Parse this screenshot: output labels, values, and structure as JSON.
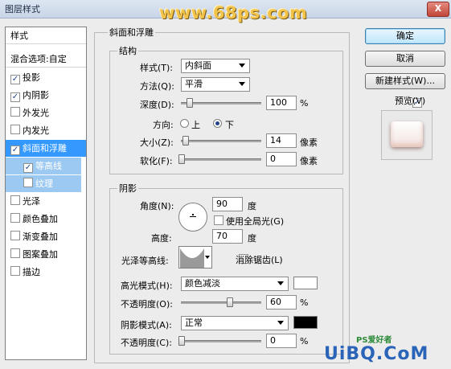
{
  "window": {
    "title": "图层样式",
    "close_glyph": "X",
    "watermark": "www.68ps.com"
  },
  "left_panel": {
    "header": "样式",
    "blend_options": "混合选项:自定",
    "items": [
      {
        "label": "投影",
        "checked": true
      },
      {
        "label": "内阴影",
        "checked": true
      },
      {
        "label": "外发光",
        "checked": false
      },
      {
        "label": "内发光",
        "checked": false
      },
      {
        "label": "斜面和浮雕",
        "checked": true,
        "selected": true
      },
      {
        "label": "等高线",
        "checked": true,
        "sub": true
      },
      {
        "label": "纹理",
        "checked": false,
        "sub": true
      },
      {
        "label": "光泽",
        "checked": false
      },
      {
        "label": "颜色叠加",
        "checked": false
      },
      {
        "label": "渐变叠加",
        "checked": false
      },
      {
        "label": "图案叠加",
        "checked": false
      },
      {
        "label": "描边",
        "checked": false
      }
    ]
  },
  "bevel": {
    "section_title": "斜面和浮雕",
    "structure_title": "结构",
    "style_label": "样式(T):",
    "style_value": "内斜面",
    "technique_label": "方法(Q):",
    "technique_value": "平滑",
    "depth_label": "深度(D):",
    "depth_value": "100",
    "depth_unit": "%",
    "depth_level": 0.1,
    "direction_label": "方向:",
    "dir_up": "上",
    "dir_down": "下",
    "direction_selected": "下",
    "size_label": "大小(Z):",
    "size_value": "14",
    "size_unit": "像素",
    "size_level": 0.05,
    "soften_label": "软化(F):",
    "soften_value": "0",
    "soften_unit": "像素",
    "soften_level": 0.0
  },
  "shading": {
    "title": "阴影",
    "angle_label": "角度(N):",
    "angle_value": "90",
    "angle_unit": "度",
    "global_light_label": "使用全局光(G)",
    "global_light_checked": false,
    "altitude_label": "高度:",
    "altitude_value": "70",
    "altitude_unit": "度",
    "gloss_contour_label": "光泽等高线:",
    "anti_alias_label": "消除锯齿(L)",
    "anti_alias_checked": false,
    "highlight_mode_label": "高光模式(H):",
    "highlight_mode_value": "颜色减淡",
    "highlight_color": "#ffffff",
    "highlight_opacity_label": "不透明度(O):",
    "highlight_opacity_value": "60",
    "highlight_opacity_unit": "%",
    "highlight_opacity_level": 0.6,
    "shadow_mode_label": "阴影模式(A):",
    "shadow_mode_value": "正常",
    "shadow_color": "#000000",
    "shadow_opacity_label": "不透明度(C):",
    "shadow_opacity_value": "0",
    "shadow_opacity_unit": "%",
    "shadow_opacity_level": 0.0
  },
  "buttons": {
    "ok": "确定",
    "cancel": "取消",
    "new_style": "新建样式(W)...",
    "preview_label": "预览(V)",
    "preview_checked": true
  },
  "logo": {
    "brand": "UiBQ.CoM",
    "tag": "PS爱好者"
  }
}
